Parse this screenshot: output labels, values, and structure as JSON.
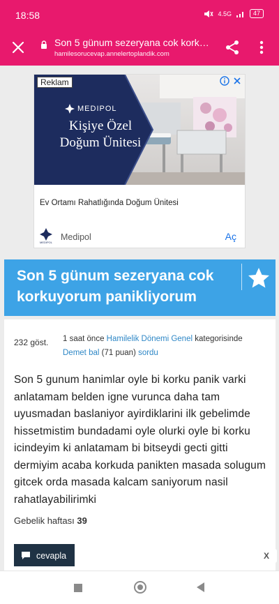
{
  "status": {
    "time": "18:58",
    "network": "4.5G",
    "battery": "47"
  },
  "toolbar": {
    "title": "Son 5 günum sezeryana cok korkuy...",
    "url": "hamilesorucevap.annelertoplandik.com"
  },
  "ad": {
    "label": "Reklam",
    "brand_top": "MEDIPOL",
    "headline": "Kişiye Özel Doğum Ünitesi",
    "description": "Ev Ortamı Rahatlığında Doğum Ünitesi",
    "advertiser": "Medipol",
    "logo_caption": "MEDIPOL",
    "cta": "Aç"
  },
  "question": {
    "title": "Son 5 günum sezeryana cok korkuyorum panikliyorum",
    "views": "232 göst.",
    "time_ago": "1 saat önce",
    "category": "Hamilelik Dönemi Genel",
    "category_suffix": "kategorisinde",
    "author": "Demet bal",
    "points": "(71 puan)",
    "action": "sordu",
    "body": "Son 5 gunum hanimlar oyle bi korku panik varki anlatamam belden igne vurunca daha tam uyusmadan baslaniyor ayirdiklarini ilk gebelimde hissetmistim bundadami oyle olurki oyle bi korku icindeyim ki anlatamam bi bitseydi gecti gitti dermiyim acaba korkuda panikten masada solugum gitcek orda masada kalcam saniyorum nasil rahatlayabilirimki",
    "week_label": "Gebelik haftası",
    "week_value": "39",
    "answer_label": "cevapla"
  },
  "overlay": {
    "close_label": "X"
  },
  "colors": {
    "brand": "#e8196d",
    "header_blue": "#3da3e6",
    "link": "#2e87c6",
    "answer_button": "#1f3244",
    "ad_cta": "#1a73e8"
  }
}
